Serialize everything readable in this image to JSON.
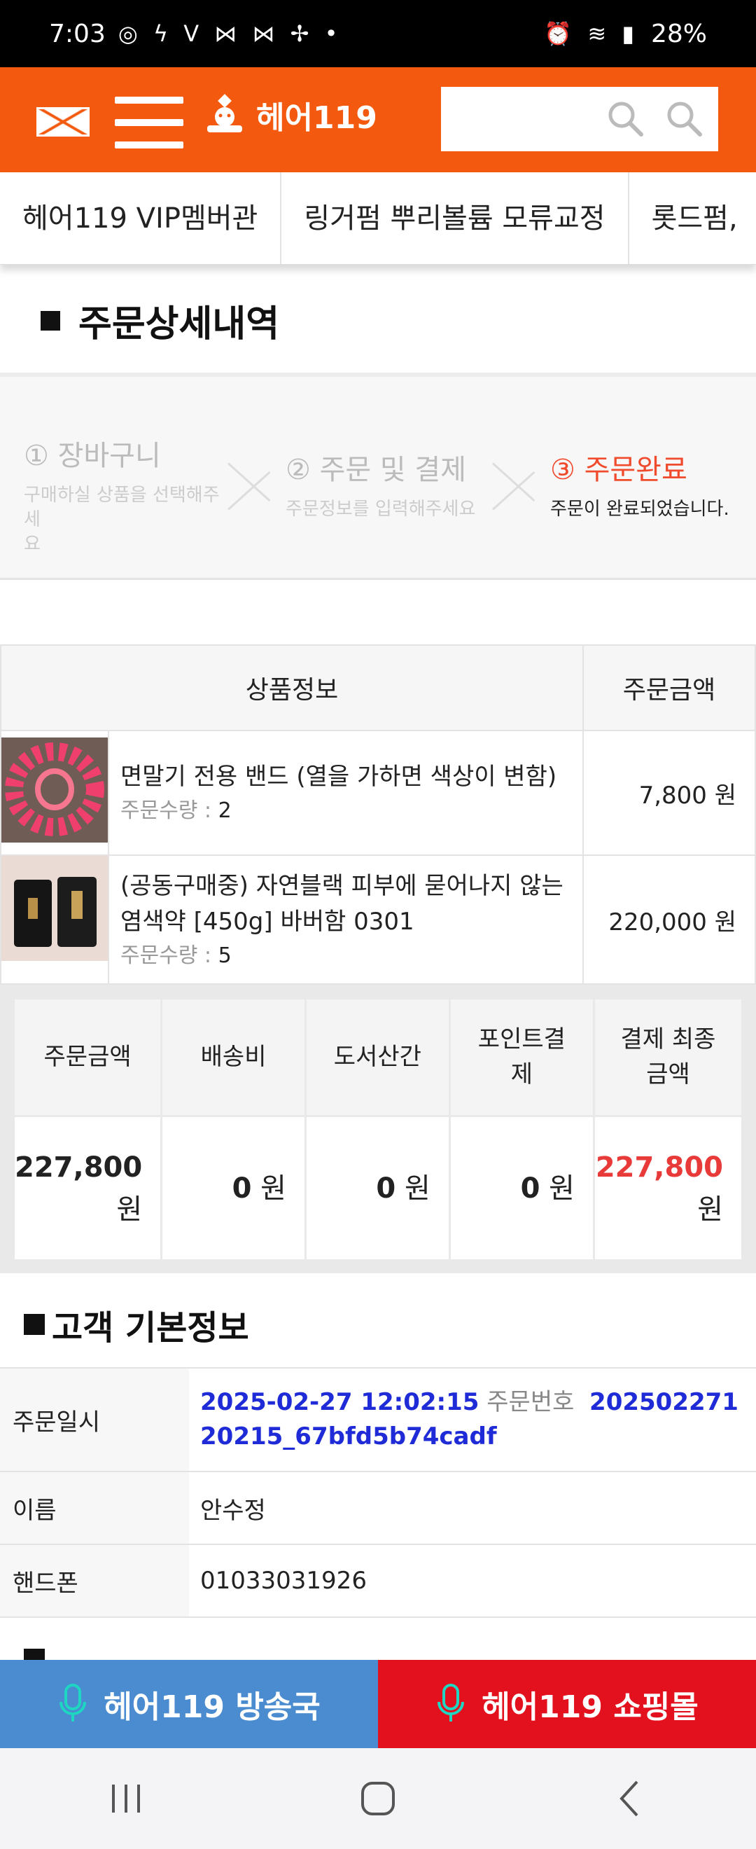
{
  "status": {
    "time": "7:03",
    "left_icons": "◎ ϟ V ⋈ ⋈ ✢ •",
    "battery": "28%",
    "right_icons": "⏰ ≋ ▮"
  },
  "header": {
    "logo_text": "헤어119",
    "search_placeholder": ""
  },
  "menu": {
    "items": [
      "헤어119 VIP멤버관",
      "링거펌 뿌리볼륨 모류교정",
      "롯드펌,"
    ]
  },
  "page": {
    "title": "주문상세내역"
  },
  "steps": [
    {
      "title": "① 장바구니",
      "desc": "구매하실 상품을 선택해주세\n요"
    },
    {
      "title": "② 주문 및 결제",
      "desc": "주문정보를 입력해주세요"
    },
    {
      "title": "③ 주문완료",
      "desc": "주문이 완료되었습니다."
    }
  ],
  "products": {
    "header_info": "상품정보",
    "header_amount": "주문금액",
    "qty_label": "주문수량 : ",
    "items": [
      {
        "name": "면말기 전용 밴드 (열을 가하면 색상이 변함)",
        "qty": "2",
        "price": "7,800 원"
      },
      {
        "name": "(공동구매중) 자연블랙 피부에 묻어나지 않는 염색약 [450g] 바버함 0301",
        "qty": "5",
        "price": "220,000 원"
      }
    ]
  },
  "summary": {
    "headers": [
      "주문금액",
      "배송비",
      "도서산간",
      "포인트결제",
      "결제 최종금액"
    ],
    "values": [
      "227,800",
      "0",
      "0",
      "0",
      "227,800"
    ],
    "unit": "원"
  },
  "customer": {
    "section_title": "고객 기본정보",
    "order_date_label": "주문일시",
    "order_date": "2025-02-27 12:02:15",
    "order_no_label": "주문번호",
    "order_no": "20250227120215_67bfd5b74cadf",
    "name_label": "이름",
    "name": "안수정",
    "phone_label": "핸드폰",
    "phone": "01033031926"
  },
  "bottom": {
    "broadcast": "헤어119 방송국",
    "shop": "헤어119 쇼핑몰"
  },
  "colors": {
    "brand_orange": "#f35a0f",
    "broadcast_blue": "#4a8ccf",
    "shop_red": "#e3101d",
    "price_red": "#e93a3a",
    "link_blue": "#1e2bd6"
  }
}
